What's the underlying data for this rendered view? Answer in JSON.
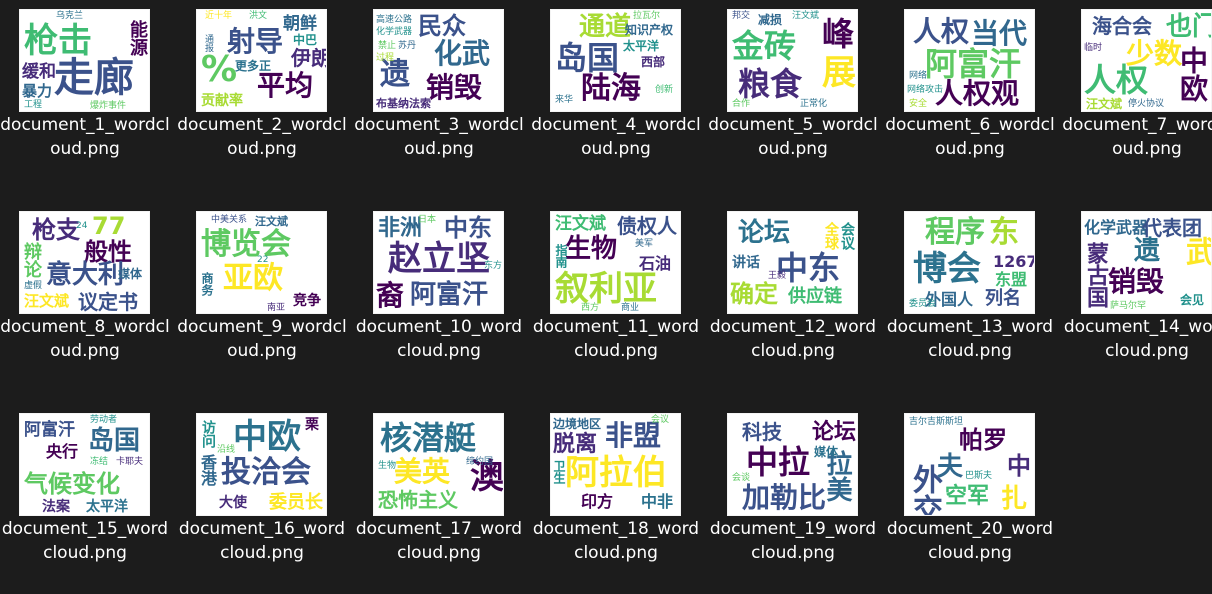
{
  "colors": {
    "background": "#1c1c1c",
    "caption_text": "#ffffff",
    "thumbnail_bg": "#ffffff"
  },
  "files": [
    {
      "name": "document_1_wordcloud.png",
      "keywords": [
        "枪击",
        "走廊",
        "能源",
        "缓和",
        "暴力",
        "工程",
        "爆炸事件",
        "乌克兰"
      ]
    },
    {
      "name": "document_2_wordcloud.png",
      "keywords": [
        "射导",
        "%",
        "平均",
        "朝鲜",
        "伊朗",
        "中巴",
        "更多正",
        "贡献率",
        "洪文",
        "通报",
        "近十年"
      ]
    },
    {
      "name": "document_3_wordcloud.png",
      "keywords": [
        "民众",
        "化武",
        "遗",
        "销毁",
        "高速公路",
        "化学武器",
        "布基纳法索",
        "禁止",
        "苏丹",
        "过程"
      ]
    },
    {
      "name": "document_4_wordcloud.png",
      "keywords": [
        "通道",
        "岛国",
        "陆海",
        "知识产权",
        "太平洋",
        "西部",
        "来华",
        "创新",
        "拉瓦尔"
      ]
    },
    {
      "name": "document_5_wordcloud.png",
      "keywords": [
        "金砖",
        "粮食",
        "峰",
        "展",
        "减损",
        "汪文斌",
        "正常化",
        "邦交",
        "合作"
      ]
    },
    {
      "name": "document_6_wordcloud.png",
      "keywords": [
        "人权",
        "当代",
        "阿富汗",
        "人权观",
        "网络",
        "网络攻击",
        "安全"
      ]
    },
    {
      "name": "document_7_wordcloud.png",
      "keywords": [
        "海合会",
        "也门",
        "少数",
        "人权",
        "中欧",
        "汪文斌",
        "停火协议",
        "临时"
      ]
    },
    {
      "name": "document_8_wordcloud.png",
      "keywords": [
        "枪支",
        "77",
        "般性",
        "意大利",
        "辩论",
        "议定书",
        "汪文斌",
        "媒体",
        "24",
        "虚假"
      ]
    },
    {
      "name": "document_9_wordcloud.png",
      "keywords": [
        "中美关系",
        "汪文斌",
        "博览会",
        "亚欧",
        "竞争",
        "22",
        "商务",
        "南亚"
      ]
    },
    {
      "name": "document_10_wordcloud.png",
      "keywords": [
        "非洲",
        "中东",
        "赵立坚",
        "裔",
        "阿富汗",
        "东方",
        "日本"
      ]
    },
    {
      "name": "document_11_wordcloud.png",
      "keywords": [
        "汪文斌",
        "债权人",
        "生物",
        "石油",
        "叙利亚",
        "美军",
        "指南",
        "商业",
        "西方"
      ]
    },
    {
      "name": "document_12_wordcloud.png",
      "keywords": [
        "论坛",
        "中东",
        "确定",
        "供应链",
        "讲话",
        "王毅",
        "全球",
        "会议"
      ]
    },
    {
      "name": "document_13_wordcloud.png",
      "keywords": [
        "程序",
        "东",
        "博会",
        "1267",
        "外国人",
        "列名",
        "东盟",
        "委员会"
      ]
    },
    {
      "name": "document_14_wordcloud.png",
      "keywords": [
        "化学武器",
        "代表团",
        "遗",
        "武",
        "蒙古国",
        "销毁",
        "萨马尔罕",
        "会见"
      ]
    },
    {
      "name": "document_15_wordcloud.png",
      "keywords": [
        "阿富汗",
        "岛国",
        "央行",
        "气候变化",
        "法案",
        "太平洋",
        "劳动者",
        "冻结",
        "卡耶夫"
      ]
    },
    {
      "name": "document_16_wordcloud.png",
      "keywords": [
        "中欧",
        "投洽会",
        "香港",
        "大使",
        "委员长",
        "访问",
        "沿线",
        "栗"
      ]
    },
    {
      "name": "document_17_wordcloud.png",
      "keywords": [
        "核潜艇",
        "美英",
        "澳",
        "恐怖主义",
        "缔约国",
        "生物"
      ]
    },
    {
      "name": "document_18_wordcloud.png",
      "keywords": [
        "边境地区",
        "非盟",
        "脱离",
        "阿拉伯",
        "印方",
        "中非",
        "卫生",
        "会议"
      ]
    },
    {
      "name": "document_19_wordcloud.png",
      "keywords": [
        "科技",
        "论坛",
        "中拉",
        "加勒比",
        "拉美",
        "媒体",
        "会谈"
      ]
    },
    {
      "name": "document_20_wordcloud.png",
      "keywords": [
        "帕罗",
        "外交",
        "空军",
        "中",
        "夫",
        "扎",
        "巴斯夫",
        "吉尔吉斯斯坦"
      ]
    }
  ]
}
